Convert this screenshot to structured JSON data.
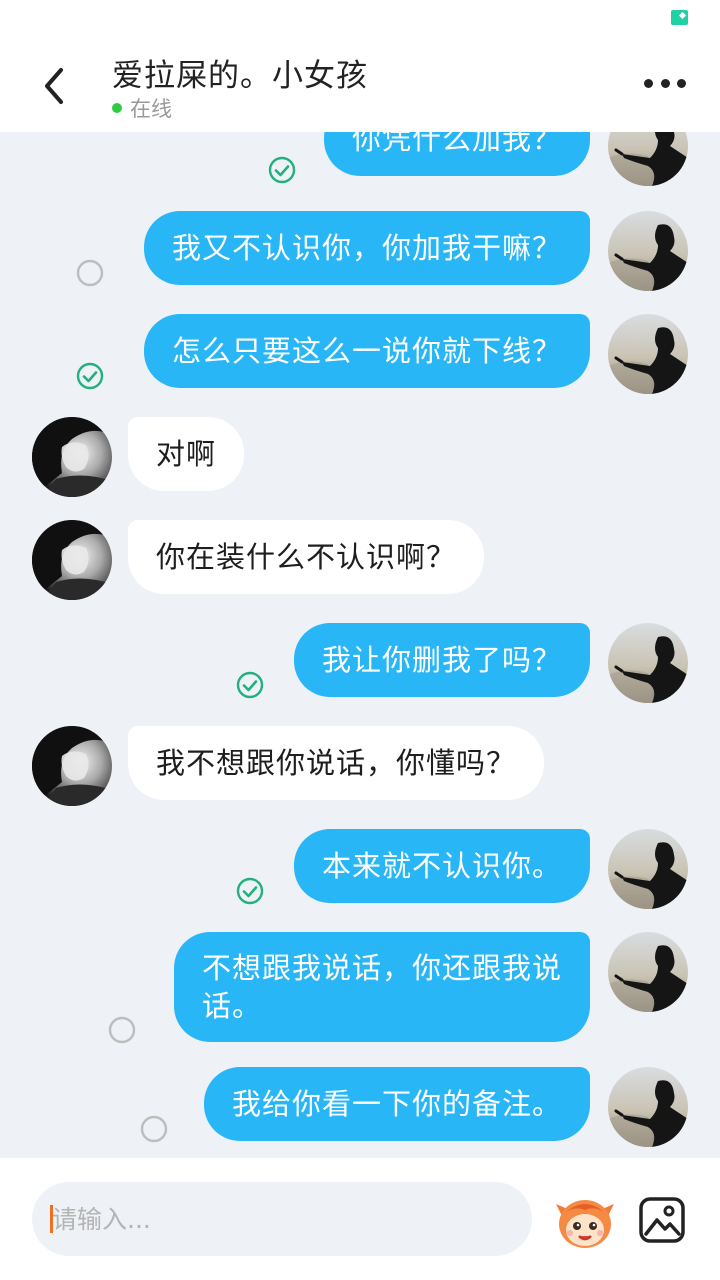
{
  "header": {
    "title": "爱拉屎的。小女孩",
    "online_text": "在线"
  },
  "icons": {
    "back": "chevron-left-icon",
    "more": "more-dots-icon",
    "read": "check-circle-icon",
    "unread": "empty-circle-icon",
    "emoji": "emoji-face-icon",
    "image": "image-icon"
  },
  "colors": {
    "outgoing_bubble": "#29b6f6",
    "incoming_bubble": "#ffffff",
    "read_check": "#22b07d",
    "online_dot": "#2ecc40",
    "background": "#eef1f6"
  },
  "messages": [
    {
      "sender": "me",
      "text": "你凭什么加我？",
      "status": "read"
    },
    {
      "sender": "me",
      "text": "我又不认识你，你加我干嘛？",
      "status": "unread"
    },
    {
      "sender": "me",
      "text": "怎么只要这么一说你就下线？",
      "status": "read"
    },
    {
      "sender": "her",
      "text": "对啊"
    },
    {
      "sender": "her",
      "text": "你在装什么不认识啊？"
    },
    {
      "sender": "me",
      "text": "我让你删我了吗？",
      "status": "read"
    },
    {
      "sender": "her",
      "text": "我不想跟你说话，你懂吗？"
    },
    {
      "sender": "me",
      "text": "本来就不认识你。",
      "status": "read"
    },
    {
      "sender": "me",
      "text_line1": "不想跟我说话，你还跟我说",
      "text_line2": "话。",
      "status": "unread"
    },
    {
      "sender": "me",
      "text": "我给你看一下你的备注。",
      "status": "unread"
    }
  ],
  "input": {
    "placeholder": "请输入..."
  }
}
